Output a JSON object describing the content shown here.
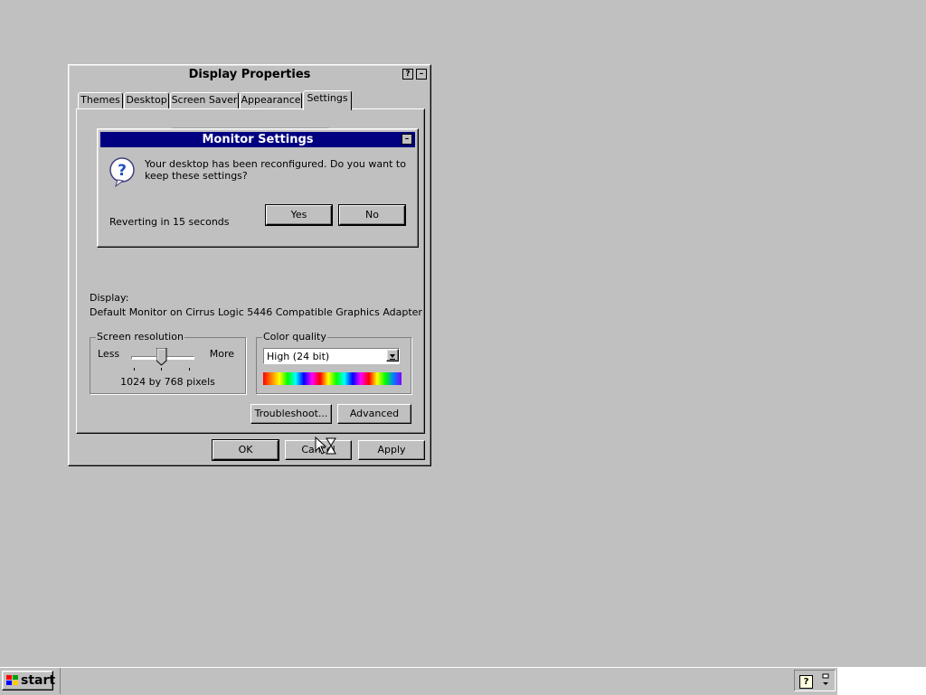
{
  "window": {
    "title": "Display Properties",
    "help_button": "?",
    "minimize_button": "–",
    "tabs": [
      {
        "label": "Themes"
      },
      {
        "label": "Desktop"
      },
      {
        "label": "Screen Saver"
      },
      {
        "label": "Appearance"
      },
      {
        "label": "Settings"
      }
    ],
    "active_tab": "Settings",
    "display_label": "Display:",
    "display_value": "Default Monitor on Cirrus Logic 5446 Compatible Graphics Adapter",
    "resolution": {
      "legend": "Screen resolution",
      "less": "Less",
      "more": "More",
      "value": "1024 by 768 pixels",
      "slider_level": 0.5
    },
    "color": {
      "legend": "Color quality",
      "selected": "High (24 bit)"
    },
    "troubleshoot_label": "Troubleshoot...",
    "advanced_label": "Advanced",
    "ok_label": "OK",
    "cancel_label": "Cancel",
    "apply_label": "Apply"
  },
  "dialog": {
    "title": "Monitor Settings",
    "message": "Your desktop has been reconfigured.  Do you want to keep these settings?",
    "countdown": "Reverting in 15 seconds",
    "yes_label": "Yes",
    "no_label": "No",
    "icon": "question-icon"
  },
  "taskbar": {
    "start_label": "start",
    "tray_icons": [
      "help-icon",
      "network-icon"
    ]
  },
  "colors": {
    "desktop": "#c0c0c0",
    "active_title": "#000080"
  }
}
